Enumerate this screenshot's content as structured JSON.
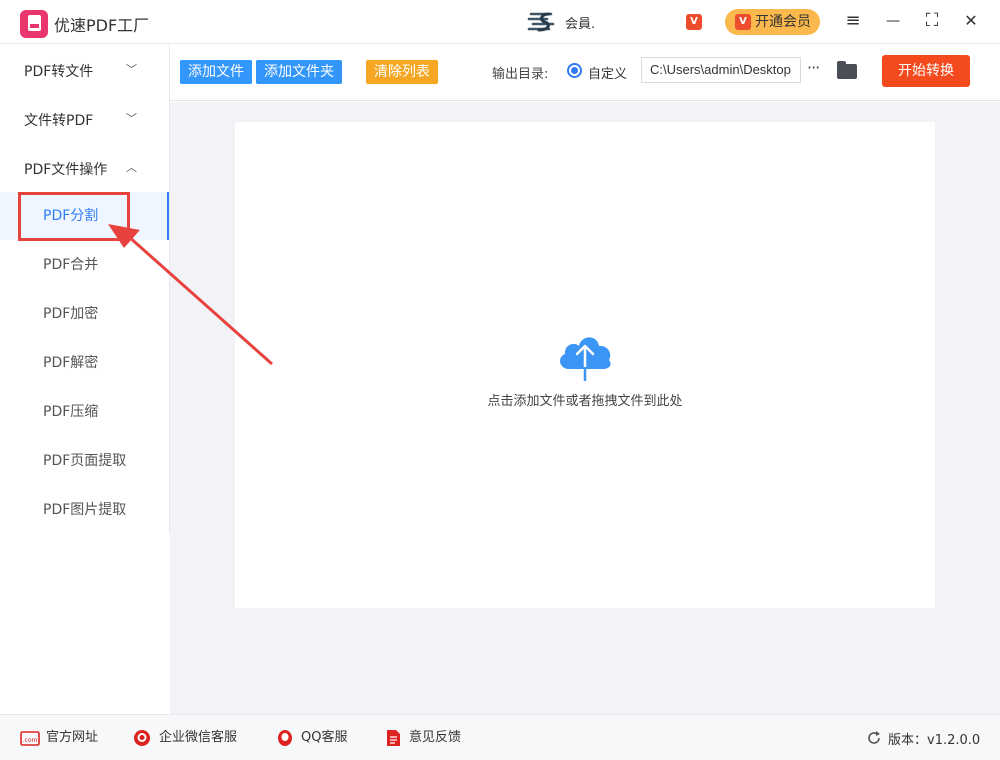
{
  "app": {
    "title": "优速PDF工厂",
    "user_name": "会員.",
    "vip_button_label": "开通会员",
    "vip_icon_text": "V"
  },
  "window_controls": {
    "menu": "≡",
    "minimize": "—",
    "maximize": "⛶",
    "close": "✕"
  },
  "sidebar": {
    "groups": [
      {
        "label": "PDF转文件",
        "chevron": "﹀"
      },
      {
        "label": "文件转PDF",
        "chevron": "﹀"
      },
      {
        "label": "PDF文件操作",
        "chevron": "︿"
      }
    ],
    "items": [
      {
        "label": "PDF分割",
        "active": true
      },
      {
        "label": "PDF合并"
      },
      {
        "label": "PDF加密"
      },
      {
        "label": "PDF解密"
      },
      {
        "label": "PDF压缩"
      },
      {
        "label": "PDF页面提取"
      },
      {
        "label": "PDF图片提取"
      }
    ]
  },
  "toolbar": {
    "add_file": "添加文件",
    "add_folder": "添加文件夹",
    "clear_list": "清除列表",
    "output_label": "输出目录:",
    "custom_label": "自定义",
    "path_value": "C:\\Users\\admin\\Desktop",
    "more": "···",
    "start": "开始转换"
  },
  "main": {
    "drop_hint": "点击添加文件或者拖拽文件到此处"
  },
  "footer": {
    "website": "官方网址",
    "wechat": "企业微信客服",
    "qq": "QQ客服",
    "feedback": "意见反馈",
    "version": "版本：v1.2.0.0"
  },
  "colors": {
    "primary_blue": "#3296fa",
    "orange": "#f5a623",
    "start_red": "#f44b1e",
    "highlight_red": "#e8423f",
    "vip_gold": "#fbb84d"
  },
  "icons": {
    "logo": "pdf-logo-icon",
    "cloud": "cloud-upload-icon",
    "folder": "folder-icon",
    "refresh": "refresh-icon"
  }
}
